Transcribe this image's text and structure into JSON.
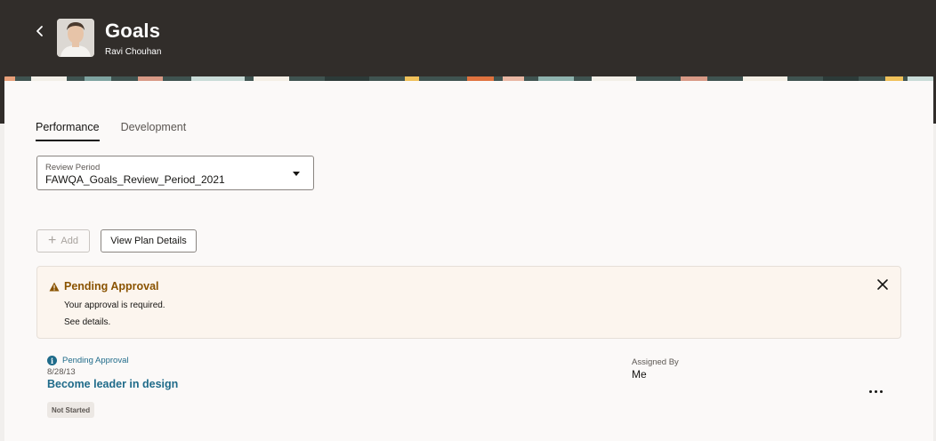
{
  "header": {
    "title": "Goals",
    "person_name": "Ravi Chouhan",
    "background_color": "#312d2a"
  },
  "tabs": [
    {
      "label": "Performance",
      "active": true
    },
    {
      "label": "Development",
      "active": false
    }
  ],
  "review_period": {
    "label": "Review Period",
    "value": "FAWQA_Goals_Review_Period_2021"
  },
  "actions": {
    "add_label": "Add",
    "view_plan_label": "View Plan Details"
  },
  "alert": {
    "title": "Pending Approval",
    "message": "Your approval is required.",
    "link": "See details.",
    "title_color": "#8a5300",
    "background_color": "#fcf5ee"
  },
  "goal": {
    "status": "Pending Approval",
    "date": "8/28/13",
    "name": "Become leader in design",
    "progress": "Not Started",
    "assigned_by_label": "Assigned By",
    "assigned_by_value": "Me",
    "link_color": "#1f6b8a"
  },
  "icons": {
    "back": "chevron-left-icon",
    "warning": "warning-triangle-icon",
    "close": "close-icon",
    "info": "info-icon",
    "more": "more-horizontal-icon",
    "add": "plus-icon"
  }
}
